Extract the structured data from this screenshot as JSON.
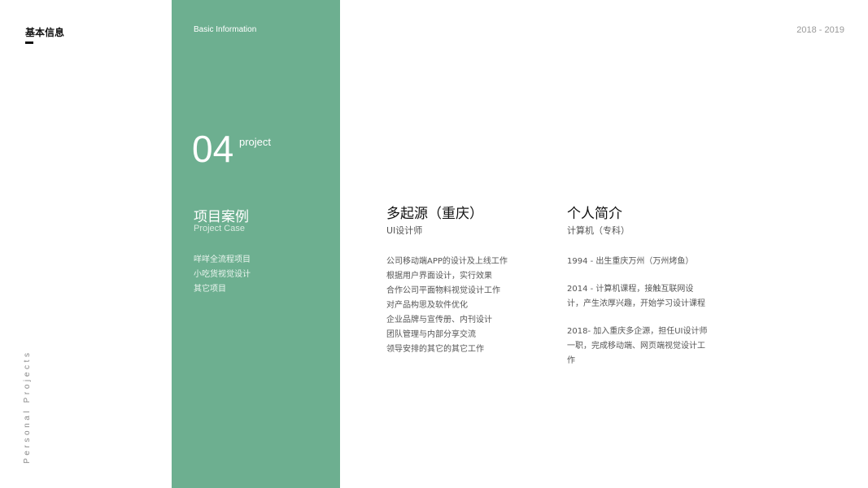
{
  "sidebar": {
    "title": "基本信息",
    "vertical_text": "Personal Projects"
  },
  "header": {
    "year_range": "2018 - 2019"
  },
  "panel": {
    "basic_info": "Basic Information",
    "number": "04",
    "number_label": "project",
    "title": "项目案例",
    "subtitle": "Project Case",
    "items": [
      "咩咩全流程项目",
      "小吃货视觉设计",
      "其它项目"
    ]
  },
  "company": {
    "title": "多起源（重庆）",
    "role": "UI设计师",
    "duties": [
      "公司移动端APP的设计及上线工作",
      "根据用户界面设计，实行效果",
      "合作公司平面物料视觉设计工作",
      "对产品构思及软件优化",
      "企业品牌与宣传册、内刊设计",
      "团队管理与内部分享交流",
      "领导安排的其它的其它工作"
    ]
  },
  "profile": {
    "title": "个人简介",
    "subtitle": "计算机（专科）",
    "timeline": [
      "1994 - 出生重庆万州（万州烤鱼）",
      "2014 - 计算机课程，接触互联网设计，产生浓厚兴趣，开始学习设计课程",
      "2018- 加入重庆多企源，担任UI设计师一职，完成移动端、网页端视觉设计工作"
    ]
  }
}
